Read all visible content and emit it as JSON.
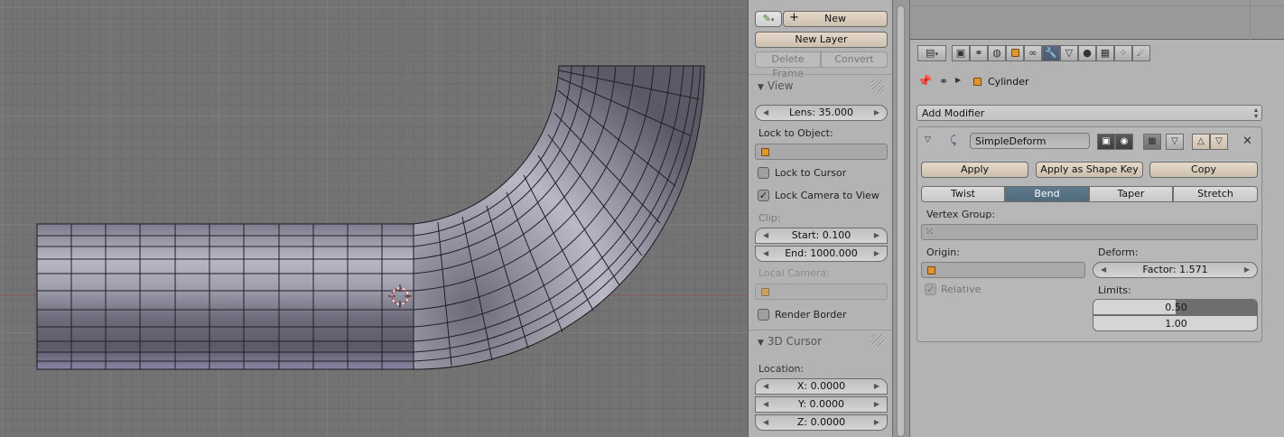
{
  "grease_pencil": {
    "new_label": "New",
    "new_layer_label": "New Layer",
    "delete_frame_label": "Delete Frame",
    "convert_label": "Convert"
  },
  "view_panel": {
    "title": "View",
    "lens_label": "Lens: 35.000",
    "lock_to_object_label": "Lock to Object:",
    "lock_to_cursor_label": "Lock to Cursor",
    "lock_to_cursor_checked": false,
    "lock_camera_label": "Lock Camera to View",
    "lock_camera_checked": true,
    "clip_label": "Clip:",
    "clip_start": "Start: 0.100",
    "clip_end": "End: 1000.000",
    "local_camera_label": "Local Camera:",
    "render_border_label": "Render Border",
    "render_border_checked": false
  },
  "cursor_panel": {
    "title": "3D Cursor",
    "location_label": "Location:",
    "x": "X: 0.0000",
    "y": "Y: 0.0000",
    "z": "Z: 0.0000"
  },
  "properties": {
    "breadcrumb_object": "Cylinder",
    "add_modifier_label": "Add Modifier",
    "tabs": [
      "render-icon",
      "scene-icon",
      "world-icon",
      "object-icon",
      "constraints-icon",
      "modifiers-icon",
      "data-icon",
      "material-icon",
      "texture-icon",
      "particles-icon",
      "physics-icon"
    ],
    "active_tab": "modifiers-icon",
    "modifier": {
      "name": "SimpleDeform",
      "apply_label": "Apply",
      "apply_shape_key_label": "Apply as Shape Key",
      "copy_label": "Copy",
      "modes": [
        "Twist",
        "Bend",
        "Taper",
        "Stretch"
      ],
      "active_mode": "Bend",
      "vertex_group_label": "Vertex Group:",
      "origin_label": "Origin:",
      "deform_label": "Deform:",
      "factor": "Factor: 1.571",
      "relative_label": "Relative",
      "relative_checked": true,
      "limits_label": "Limits:",
      "limit_upper": "0.50",
      "limit_upper_fraction": 0.5,
      "limit_lower": "1.00"
    }
  },
  "colors": {
    "active_tab": "#4a5870",
    "active_mode": "#4f6b7c",
    "button": "#d8ccbb",
    "object_cube": "#e0962e"
  }
}
